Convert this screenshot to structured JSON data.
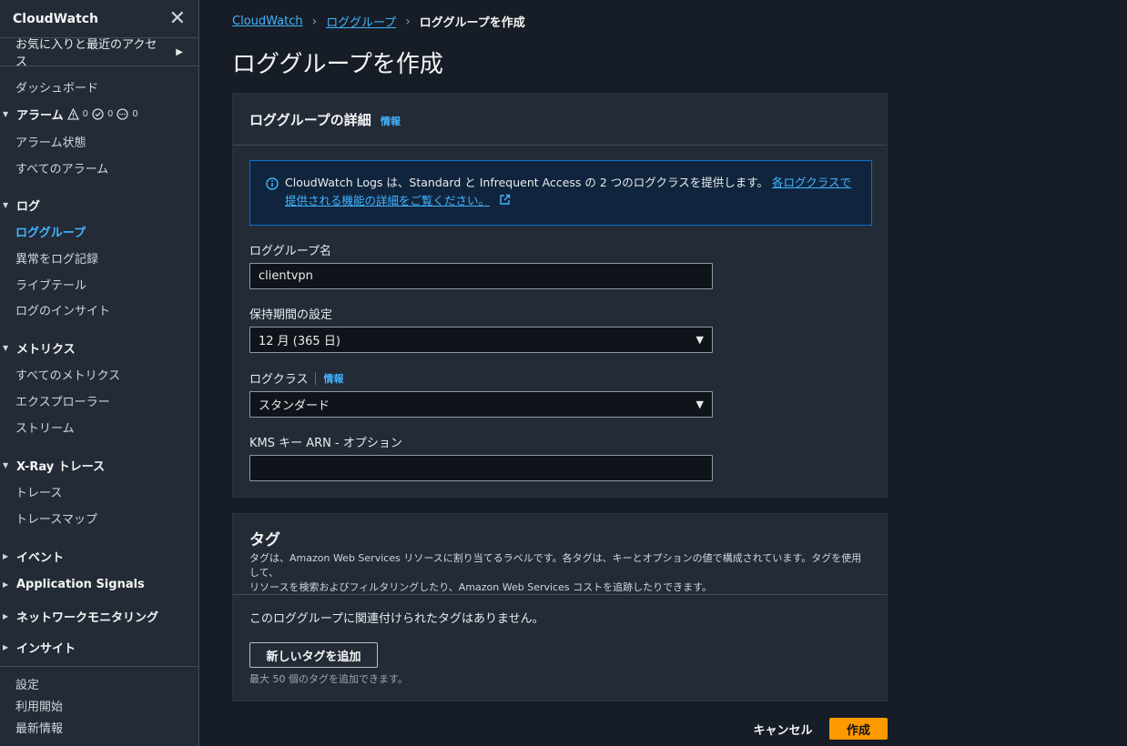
{
  "sidebar": {
    "title": "CloudWatch",
    "favorites": "お気に入りと最近のアクセス",
    "dashboard": "ダッシュボード",
    "alarms": {
      "label": "アラーム",
      "alarm_count": "0",
      "ok_count": "0",
      "insufficient_count": "0",
      "items": [
        "アラーム状態",
        "すべてのアラーム"
      ]
    },
    "logs": {
      "label": "ログ",
      "items": [
        "ロググループ",
        "異常をログ記録",
        "ライブテール",
        "ログのインサイト"
      ]
    },
    "metrics": {
      "label": "メトリクス",
      "items": [
        "すべてのメトリクス",
        "エクスプローラー",
        "ストリーム"
      ]
    },
    "xray": {
      "label": "X-Ray トレース",
      "items": [
        "トレース",
        "トレースマップ"
      ]
    },
    "events": "イベント",
    "app_signals": "Application Signals",
    "network": "ネットワークモニタリング",
    "insights": "インサイト",
    "footer": [
      "設定",
      "利用開始",
      "最新情報"
    ]
  },
  "breadcrumb": {
    "root": "CloudWatch",
    "parent": "ロググループ",
    "current": "ロググループを作成"
  },
  "page_title": "ロググループを作成",
  "details": {
    "title": "ロググループの詳細",
    "info": "情報",
    "notice_text": "CloudWatch Logs は、Standard と Infrequent Access の 2 つのログクラスを提供します。",
    "notice_link": "各ログクラスで提供される機能の詳細をご覧ください。",
    "name_label": "ロググループ名",
    "name_value": "clientvpn",
    "retention_label": "保持期間の設定",
    "retention_value": "12 月 (365 日)",
    "class_label": "ログクラス",
    "class_info": "情報",
    "class_value": "スタンダード",
    "kms_label": "KMS キー ARN - オプション",
    "kms_value": ""
  },
  "tags": {
    "title": "タグ",
    "description_line1": "タグは、Amazon Web Services リソースに割り当てるラベルです。各タグは、キーとオプションの値で構成されています。タグを使用して、",
    "description_line2": "リソースを検索およびフィルタリングしたり、Amazon Web Services コストを追跡したりできます。",
    "empty_text": "このロググループに関連付けられたタグはありません。",
    "add_button": "新しいタグを追加",
    "hint": "最大 50 個のタグを追加できます。"
  },
  "actions": {
    "cancel": "キャンセル",
    "create": "作成"
  },
  "colors": {
    "accent_link": "#42b4ff",
    "primary_button": "#ff9900",
    "info_border": "#0972d3"
  }
}
